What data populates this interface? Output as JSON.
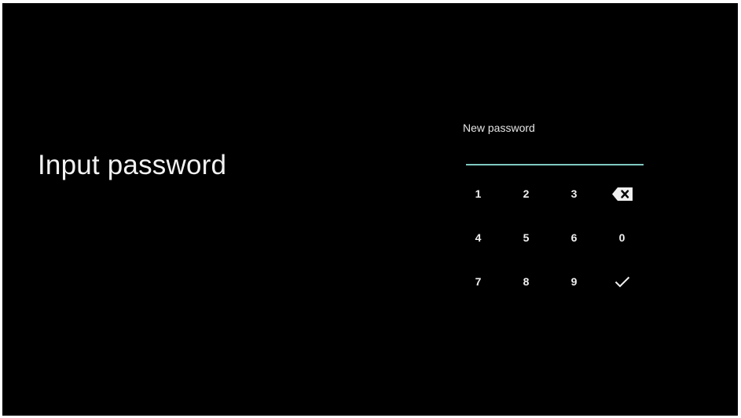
{
  "screen": {
    "title": "Input password"
  },
  "password_field": {
    "label": "New password",
    "value": ""
  },
  "keypad": {
    "rows": [
      [
        {
          "label": "1",
          "name": "key-1"
        },
        {
          "label": "2",
          "name": "key-2"
        },
        {
          "label": "3",
          "name": "key-3"
        },
        {
          "icon": "backspace-icon",
          "name": "backspace-button"
        }
      ],
      [
        {
          "label": "4",
          "name": "key-4"
        },
        {
          "label": "5",
          "name": "key-5"
        },
        {
          "label": "6",
          "name": "key-6"
        },
        {
          "label": "0",
          "name": "key-0"
        }
      ],
      [
        {
          "label": "7",
          "name": "key-7"
        },
        {
          "label": "8",
          "name": "key-8"
        },
        {
          "label": "9",
          "name": "key-9"
        },
        {
          "icon": "checkmark-icon",
          "name": "confirm-button"
        }
      ]
    ]
  },
  "colors": {
    "background": "#000000",
    "text": "#f2f2f2",
    "accent_underline": "#7fc9c2"
  }
}
